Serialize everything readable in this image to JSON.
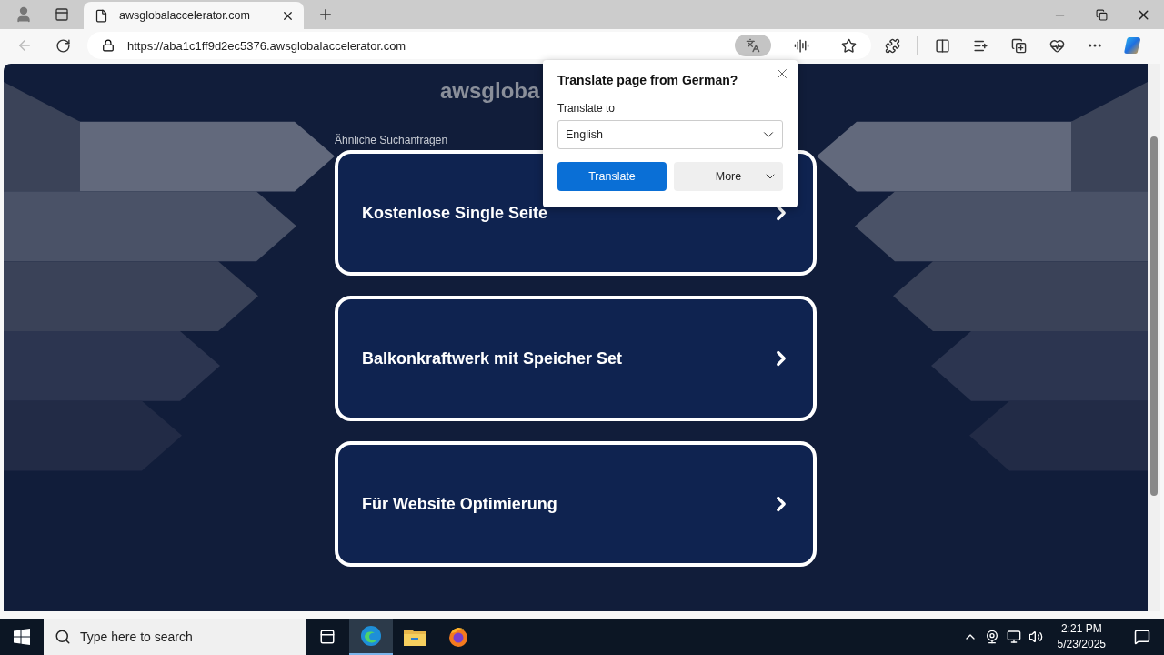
{
  "browser": {
    "tabs": [
      {
        "title": "awsglobalaccelerator.com",
        "selected": true
      }
    ],
    "address": "https://aba1c1ff9d2ec5376.awsglobalaccelerator.com"
  },
  "page": {
    "heading": "awsgloba",
    "related_label": "Ähnliche Suchanfragen",
    "links": [
      {
        "label": "Kostenlose Single Seite"
      },
      {
        "label": "Balkonkraftwerk mit Speicher Set"
      },
      {
        "label": "Für Website Optimierung"
      }
    ]
  },
  "translate_popup": {
    "title": "Translate page from  German?",
    "field_label": "Translate to",
    "language": "English",
    "primary_button": "Translate",
    "secondary_button": "More"
  },
  "taskbar": {
    "search_placeholder": "Type here to search",
    "time": "2:21 PM",
    "date": "5/23/2025"
  }
}
